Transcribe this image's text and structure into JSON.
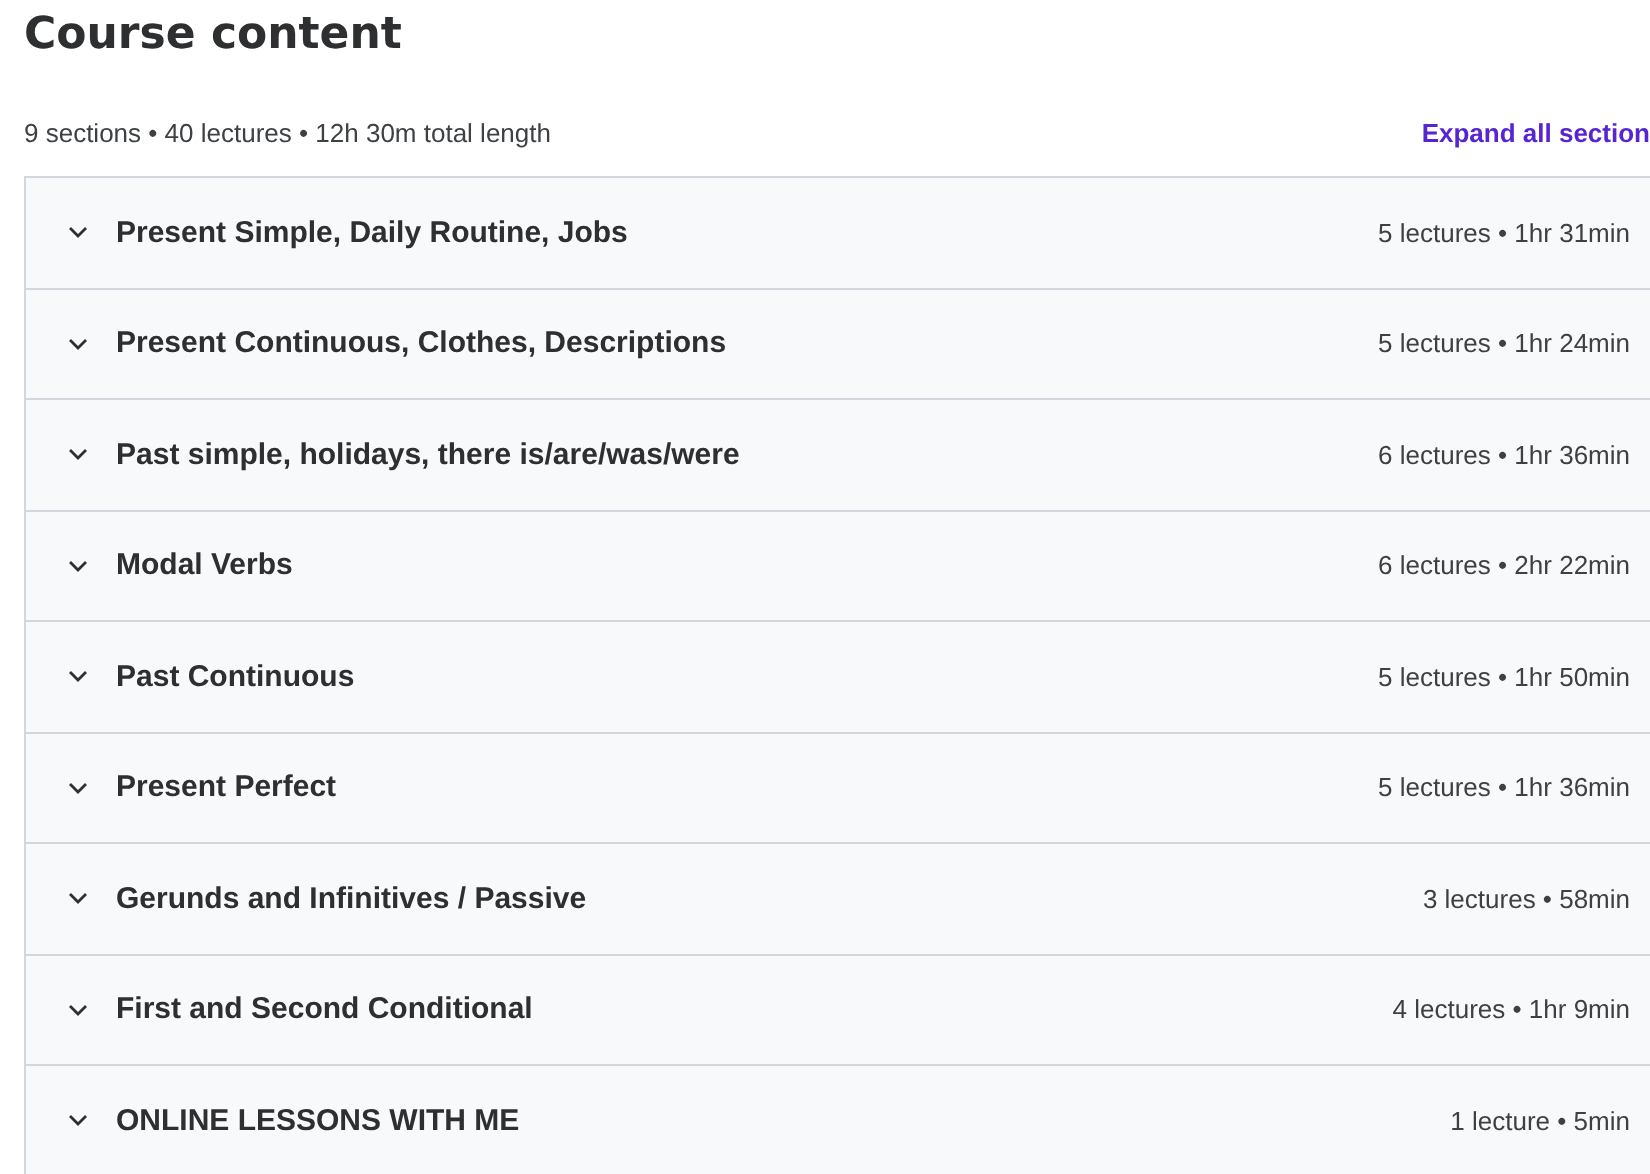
{
  "title": "Course content",
  "summary": "9 sections • 40 lectures • 12h 30m total length",
  "expand_all": "Expand all section",
  "sections": [
    {
      "title": "Present Simple, Daily Routine, Jobs",
      "meta": "5 lectures • 1hr 31min",
      "expanded": false
    },
    {
      "title": "Present Continuous, Clothes, Descriptions",
      "meta": "5 lectures • 1hr 24min",
      "expanded": false
    },
    {
      "title": "Past simple, holidays, there is/are/was/were",
      "meta": "6 lectures • 1hr 36min",
      "expanded": false
    },
    {
      "title": "Modal Verbs",
      "meta": "6 lectures • 2hr 22min",
      "expanded": false
    },
    {
      "title": "Past Continuous",
      "meta": "5 lectures • 1hr 50min",
      "expanded": false
    },
    {
      "title": "Present Perfect",
      "meta": "5 lectures • 1hr 36min",
      "expanded": false
    },
    {
      "title": "Gerunds and Infinitives / Passive",
      "meta": "3 lectures • 58min",
      "expanded": false
    },
    {
      "title": "First and Second Conditional",
      "meta": "4 lectures • 1hr 9min",
      "expanded": false
    },
    {
      "title": "ONLINE LESSONS WITH ME",
      "meta": "1 lecture • 5min",
      "expanded": false
    }
  ]
}
